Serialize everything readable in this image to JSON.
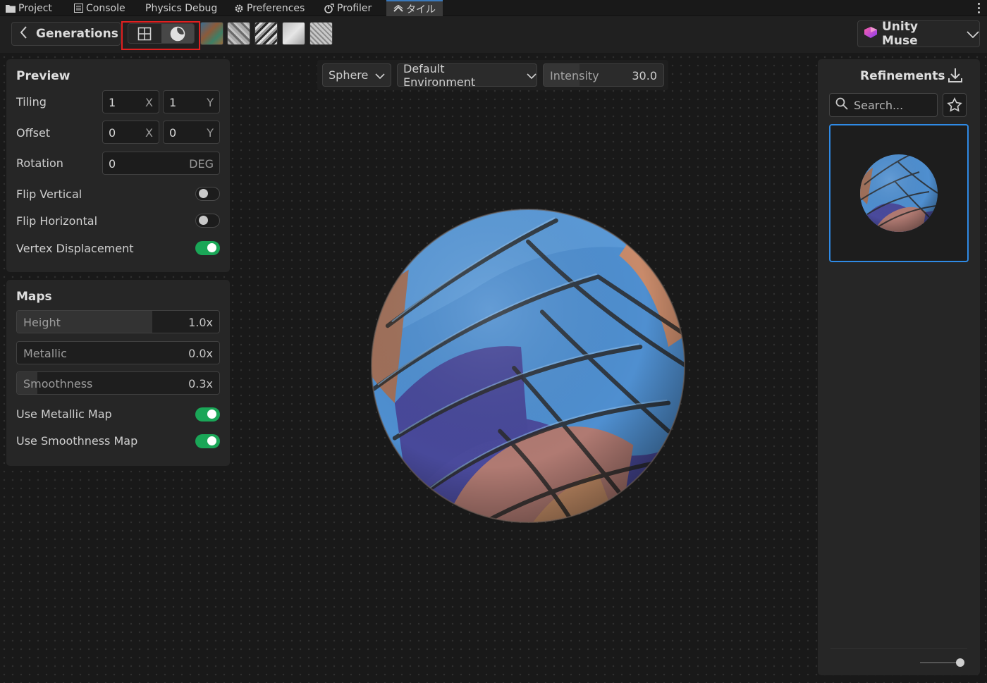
{
  "tabs": [
    {
      "label": "Project",
      "icon": "folder-icon",
      "active": false
    },
    {
      "label": "Console",
      "icon": "console-icon",
      "active": false
    },
    {
      "label": "Physics Debug",
      "icon": "",
      "active": false
    },
    {
      "label": "Preferences",
      "icon": "gear-icon",
      "active": false
    },
    {
      "label": "Profiler",
      "icon": "profiler-icon",
      "active": false
    },
    {
      "label": "タイル",
      "icon": "muse-texture-icon",
      "active": true
    }
  ],
  "toolbar": {
    "back_label": "Generations",
    "view_modes": [
      "grid-view",
      "material-preview"
    ],
    "selected_view_mode": "material-preview",
    "muse_label": "Unity Muse"
  },
  "preview": {
    "title": "Preview",
    "tiling": {
      "label": "Tiling",
      "x": "1",
      "y": "1",
      "x_suffix": "X",
      "y_suffix": "Y"
    },
    "offset": {
      "label": "Offset",
      "x": "0",
      "y": "0",
      "x_suffix": "X",
      "y_suffix": "Y"
    },
    "rotation": {
      "label": "Rotation",
      "value": "0",
      "suffix": "DEG"
    },
    "flip_vertical": {
      "label": "Flip Vertical",
      "on": false
    },
    "flip_horizontal": {
      "label": "Flip Horizontal",
      "on": false
    },
    "vertex_displacement": {
      "label": "Vertex Displacement",
      "on": true
    }
  },
  "maps": {
    "title": "Maps",
    "height": {
      "label": "Height",
      "value": "1.0x",
      "fraction": 0.67
    },
    "metallic": {
      "label": "Metallic",
      "value": "0.0x",
      "fraction": 0.0
    },
    "smoothness": {
      "label": "Smoothness",
      "value": "0.3x",
      "fraction": 0.1
    },
    "use_metallic_map": {
      "label": "Use Metallic Map",
      "on": true
    },
    "use_smoothness_map": {
      "label": "Use Smoothness Map",
      "on": true
    }
  },
  "viewport": {
    "shape": "Sphere",
    "environment": "Default Environment",
    "intensity_label": "Intensity",
    "intensity_value": "30.0",
    "intensity_fraction": 0.3
  },
  "refinements": {
    "title": "Refinements",
    "search_placeholder": "Search..."
  },
  "colors": {
    "accent": "#2f8ae5",
    "toggle_on": "#1aa657",
    "highlight": "#e02020",
    "active_tab": "#3a79bb"
  }
}
